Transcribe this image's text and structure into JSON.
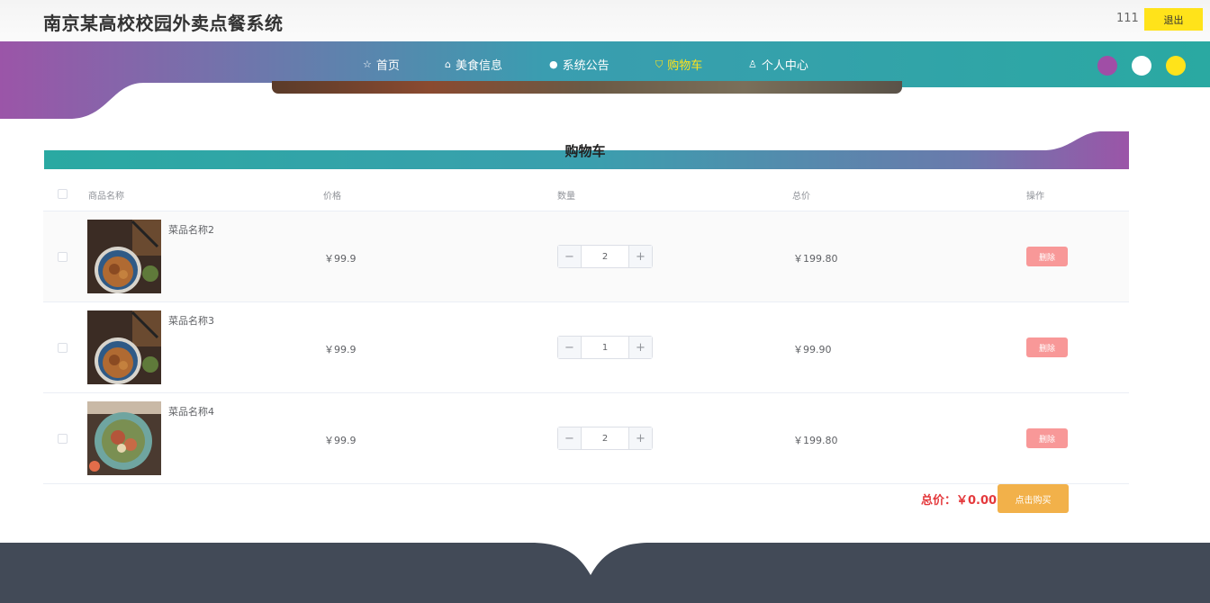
{
  "header": {
    "site_title": "南京某高校校园外卖点餐系统",
    "user_name": "111",
    "logout_label": "退出"
  },
  "nav": {
    "items": [
      {
        "label": "首页",
        "icon": "star-icon"
      },
      {
        "label": "美食信息",
        "icon": "bag-icon"
      },
      {
        "label": "系统公告",
        "icon": "info-dot-icon"
      },
      {
        "label": "购物车",
        "icon": "cart-icon",
        "active": true
      },
      {
        "label": "个人中心",
        "icon": "user-icon"
      }
    ],
    "theme_colors": [
      "#a04ea6",
      "#ffffff",
      "#ffe31a"
    ]
  },
  "colors": {
    "teal": "#2aa9a2",
    "purple": "#9b55a8",
    "accent_yellow": "#ffe31a",
    "delete_red": "#f89898",
    "buy_orange": "#f2b14a",
    "total_red": "#e4393c",
    "footer": "#424a57"
  },
  "cart": {
    "section_title": "购物车",
    "columns": {
      "name": "商品名称",
      "price": "价格",
      "quantity": "数量",
      "total": "总价",
      "action": "操作"
    },
    "rows": [
      {
        "name": "菜品名称2",
        "price": "￥99.9",
        "quantity": "2",
        "total": "￥199.80",
        "delete_label": "删除"
      },
      {
        "name": "菜品名称3",
        "price": "￥99.9",
        "quantity": "1",
        "total": "￥99.90",
        "delete_label": "删除"
      },
      {
        "name": "菜品名称4",
        "price": "￥99.9",
        "quantity": "2",
        "total": "￥199.80",
        "delete_label": "删除"
      }
    ],
    "stepper": {
      "minus": "−",
      "plus": "+"
    },
    "sum_label": "总价：￥0.00",
    "buy_label": "点击购买"
  }
}
